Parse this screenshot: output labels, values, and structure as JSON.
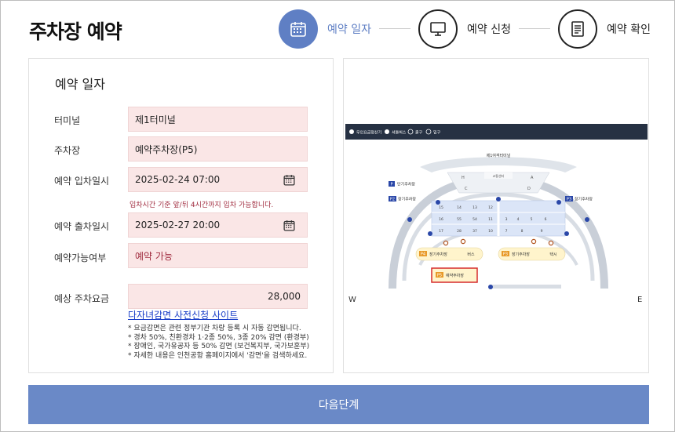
{
  "page": {
    "title": "주차장 예약"
  },
  "steps": [
    {
      "label": "예약 일자",
      "icon": "calendar-icon",
      "active": true
    },
    {
      "label": "예약 신청",
      "icon": "monitor-icon",
      "active": false
    },
    {
      "label": "예약 확인",
      "icon": "document-icon",
      "active": false
    }
  ],
  "form": {
    "section_title": "예약 일자",
    "terminal_label": "터미널",
    "terminal_value": "제1터미널",
    "parking_label": "주차장",
    "parking_value": "예약주차장(P5)",
    "entry_label": "예약 입차일시",
    "entry_value": "2025-02-24 07:00",
    "entry_hint": "입차시간 기준 앞/뒤 4시간까지 입차 가능합니다.",
    "exit_label": "예약 출차일시",
    "exit_value": "2025-02-27 20:00",
    "availability_label": "예약가능여부",
    "availability_value": "예약 가능",
    "fee_label": "예상 주차요금",
    "fee_value": "28,000",
    "discount_link": "다자녀감면 사전신청 사이트",
    "notes": [
      "* 요금감면은 관련 정부기관 차량 등록 시 자동 감면됩니다.",
      "* 경차 50%, 친환경차 1·2종 50%, 3종 20% 감면 (환경부)",
      "* 장애인, 국가유공자 등 50% 감면 (보건복지부, 국가보훈부)",
      "* 자세한 내용은 인천공항 홈페이지에서 '감면'을 검색하세요."
    ]
  },
  "map": {
    "legend": [
      "무인요금정산기",
      "셔틀버스",
      "출구",
      "입구"
    ],
    "terminal_label": "제1여객터미널",
    "gate_labels": [
      "H",
      "A",
      "C",
      "D"
    ],
    "center_label": "교통센터",
    "lot_labels": {
      "short_term": "단기주차장",
      "long_term_p2": "장기주차장",
      "long_term_p3": "장기주차장",
      "long_term_right": "장기주차장",
      "p4": "장기주차장",
      "p3_bottom": "장기주차장",
      "p5": "예약주차장",
      "bus": "버스",
      "taxi": "택시"
    },
    "lot_badges": {
      "p": "P",
      "p2": "P2",
      "p3": "P3",
      "p4": "P4",
      "p5": "P5"
    },
    "grid_numbers": [
      "15",
      "14",
      "13",
      "12",
      "16",
      "55",
      "54",
      "11",
      "17",
      "28",
      "37",
      "10",
      "3",
      "4",
      "5",
      "6",
      "7",
      "8",
      "9"
    ],
    "compass_w": "W",
    "compass_e": "E",
    "colors": {
      "header_bar": "#263143",
      "road": "#c9cfd8",
      "terminal": "#dfe4ea",
      "lot": "#dbe5f7",
      "p5_border": "#d62b2b",
      "lot_yellow": "#fff4cc",
      "badge_orange": "#e89a28",
      "badge_blue": "#2a47a8"
    }
  },
  "actions": {
    "next_label": "다음단계"
  },
  "colors": {
    "accent": "#5f7fc4",
    "field_bg": "#fae6e6",
    "warn": "#a02b3e",
    "link": "#1a3ec8",
    "button": "#6a89c7"
  }
}
